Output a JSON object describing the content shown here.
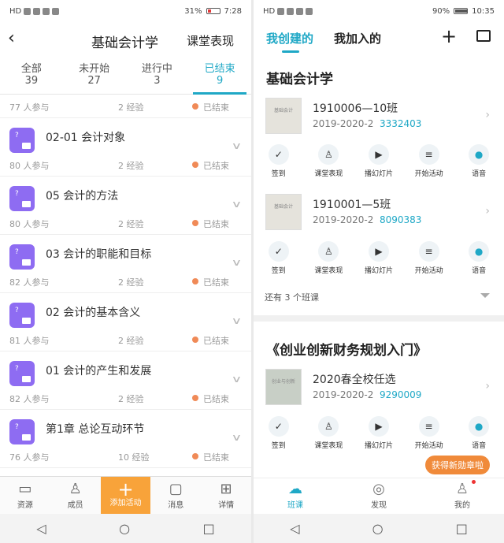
{
  "left": {
    "status": {
      "carrier": "HD",
      "percent": "31%",
      "time": "7:28"
    },
    "header": {
      "back": "‹",
      "title": "基础会计学",
      "action": "课堂表现"
    },
    "tabs": [
      {
        "label": "全部",
        "count": "39"
      },
      {
        "label": "未开始",
        "count": "27"
      },
      {
        "label": "进行中",
        "count": "3"
      },
      {
        "label": "已结束",
        "count": "9",
        "active": true
      }
    ],
    "activities": [
      {
        "name": "",
        "participants": "77 人参与",
        "exp": "2 经验",
        "status": "已结束"
      },
      {
        "name": "02-01  会计对象",
        "participants": "80 人参与",
        "exp": "2 经验",
        "status": "已结束"
      },
      {
        "name": "05 会计的方法",
        "participants": "80 人参与",
        "exp": "2 经验",
        "status": "已结束"
      },
      {
        "name": "03 会计的职能和目标",
        "participants": "82 人参与",
        "exp": "2 经验",
        "status": "已结束"
      },
      {
        "name": "02 会计的基本含义",
        "participants": "81 人参与",
        "exp": "2 经验",
        "status": "已结束"
      },
      {
        "name": "01 会计的产生和发展",
        "participants": "82 人参与",
        "exp": "2 经验",
        "status": "已结束"
      },
      {
        "name": "第1章  总论互动环节",
        "participants": "76 人参与",
        "exp": "10 经验",
        "status": "已结束"
      }
    ],
    "bottom_nav": [
      "资源",
      "成员",
      "添加活动",
      "消息",
      "详情"
    ]
  },
  "right": {
    "status": {
      "carrier": "HD",
      "percent": "90%",
      "time": "10:35"
    },
    "header": {
      "tab_created": "我创建的",
      "tab_joined": "我加入的"
    },
    "courses": [
      {
        "title": "基础会计学",
        "classes": [
          {
            "name": "1910006—10班",
            "term": "2019-2020-2",
            "code": "3332403",
            "thumb": "基础会计"
          },
          {
            "name": "1910001—5班",
            "term": "2019-2020-2",
            "code": "8090383",
            "thumb": "基础会计"
          }
        ],
        "more": "还有 3 个班课"
      },
      {
        "title": "《创业创新财务规划入门》",
        "classes": [
          {
            "name": "2020春全校任选",
            "term": "2019-2020-2",
            "code": "9290009",
            "thumb": "创业与创新"
          }
        ]
      }
    ],
    "tools": [
      "签到",
      "课堂表现",
      "播幻灯片",
      "开始活动",
      "语音"
    ],
    "badge": "获得新勋章啦",
    "bottom_nav": [
      "班课",
      "发现",
      "我的"
    ]
  }
}
